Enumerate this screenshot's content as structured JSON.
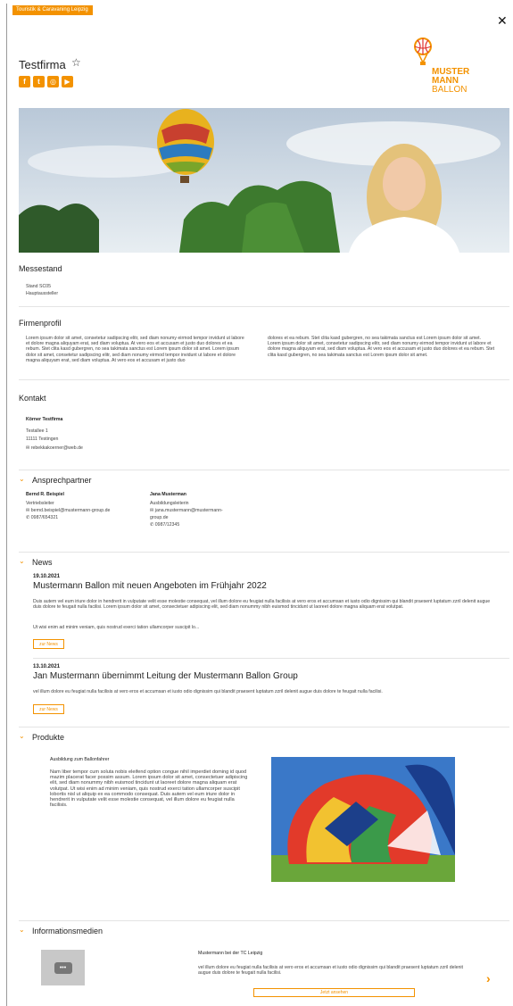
{
  "header": {
    "tag": "Touristik & Caravaning Leipzig",
    "company_name": "Testfirma",
    "social_icons": [
      "facebook-icon",
      "twitter-icon",
      "instagram-icon",
      "youtube-icon"
    ],
    "logo": {
      "line1": "MUSTER",
      "line2": "MANN",
      "line3": "BALLON"
    },
    "accent": "#f39200"
  },
  "messestand": {
    "title": "Messestand",
    "stand": "Stand SC05",
    "type": "Hauptaussteller"
  },
  "firmenprofil": {
    "title": "Firmenprofil",
    "col1": "Lorem ipsum dolor sit amet, consetetur sadipscing elitr, sed diam nonumy eirmod tempor invidunt ut labore et dolore magna aliquyam erat, sed diam voluptua. At vero eos et accusam et justo duo dolores et ea rebum. Stet clita kasd gubergren, no sea takimata sanctus est Lorem ipsum dolor sit amet. Lorem ipsum dolor sit amet, consetetur sadipscing elitr, sed diam nonumy eirmod tempor invidunt ut labore et dolore magna aliquyam erat, sed diam voluptua. At vero eos et accusam et justo duo",
    "col2": "dolores et ea rebum. Stet clita kasd gubergren, no sea takimata sanctus est Lorem ipsum dolor sit amet. Lorem ipsum dolor sit amet, consetetur sadipscing elitr, sed diam nonumy eirmod tempor invidunt ut labore et dolore magna aliquyam erat, sed diam voluptua. At vero eos et accusam et justo duo dolores et ea rebum. Stet clita kasd gubergren, no sea takimata sanctus est Lorem ipsum dolor sit amet."
  },
  "kontakt": {
    "title": "Kontakt",
    "name": "Körner Testfirma",
    "street": "Testallee 1",
    "city": "11111 Testingen",
    "email": "rebekkakoerner@web.de"
  },
  "ansprechpartner": {
    "title": "Ansprechpartner",
    "people": [
      {
        "name": "Bernd R. Beispiel",
        "role": "Vertriebsleiter",
        "email": "bernd.beispiel@mustermann-group.de",
        "phone": "0987/654321"
      },
      {
        "name": "Jana Musterman",
        "role": "Ausbildungsleiterin",
        "email": "jana.mustermann@mustermann-",
        "email2": "group.de",
        "phone": "0987/12345"
      }
    ]
  },
  "news": {
    "title": "News",
    "items": [
      {
        "date": "19.10.2021",
        "headline": "Mustermann Ballon mit neuen Angeboten im Frühjahr 2022",
        "text1": "Duis autem vel eum iriure dolor in hendrerit in vulputate velit esse molestie consequat, vel illum dolore eu feugiat nulla facilisis at vero eros et accumsan et iusto odio dignissim qui blandit praesent luptatum zzril delenit augue duis dolore te feugait nulla facilisi. Lorem ipsum dolor sit amet, consectetuer adipiscing elit, sed diam nonummy nibh euismod tincidunt ut laoreet dolore magna aliquam erat volutpat.",
        "text2": "Ut wisi enim ad minim veniam, quis nostrud exerci tation ullamcorper suscipit lo...",
        "button": "zur News"
      },
      {
        "date": "13.10.2021",
        "headline": "Jan Mustermann übernimmt Leitung der Mustermann Ballon Group",
        "text1": "vel illum dolore eu feugiat nulla facilisis at vero eros et accumsan et iusto odio dignissim qui blandit praesent luptatum zzril delenit augue duis dolore te feugait nulla facilisi.",
        "button": "zur News"
      }
    ]
  },
  "produkte": {
    "title": "Produkte",
    "product_title": "Ausbildung zum Ballonfahrer",
    "product_text": "Nam liber tempor cum soluta nobis eleifend option congue nihil imperdiet doming id quod mazim placerat facer possim assum. Lorem ipsum dolor sit amet, consectetuer adipiscing elit, sed diam nonummy nibh euismod tincidunt ut laoreet dolore magna aliquam erat volutpat. Ut wisi enim ad minim veniam, quis nostrud exerci tation ullamcorper suscipit lobortis nisl ut aliquip ex ea commodo consequat. Duis autem vel eum iriure dolor in hendrerit in vulputate velit esse molestie consequat, vel illum dolore eu feugiat nulla facilisis."
  },
  "informationsmedien": {
    "title": "Informationsmedien",
    "media_title": "Mustermann bei der TC Leipzig",
    "media_text": "vel illum dolore eu feugiat nulla facilisis at vero eros et accumsan et iusto odio dignissim qui blandit praesent luptatum zzril delenit augue duis dolore te feugait nulla facilisi.",
    "button": "Jetzt ansehen"
  },
  "icons": {
    "close": "close-icon",
    "star": "star-icon",
    "chevron": "chevron-down-icon",
    "next": "chevron-right-icon",
    "chat": "chat-bubble-icon"
  }
}
